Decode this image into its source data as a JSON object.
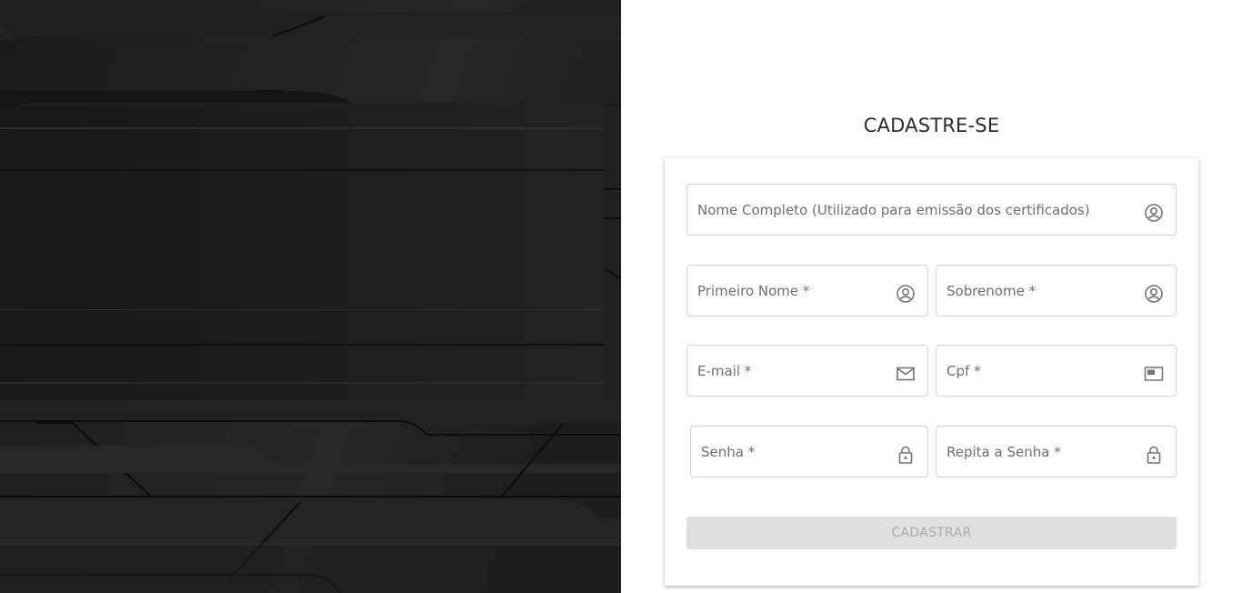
{
  "title": "CADASTRE-SE",
  "form": {
    "full_name": {
      "placeholder": "Nome Completo (Utilizado para emissão dos certificados)",
      "icon": "account-circle-icon"
    },
    "first_name": {
      "placeholder": "Primeiro Nome *",
      "icon": "account-circle-icon"
    },
    "last_name": {
      "placeholder": "Sobrenome *",
      "icon": "account-circle-icon"
    },
    "email": {
      "placeholder": "E-mail *",
      "icon": "mail-icon"
    },
    "cpf": {
      "placeholder": "Cpf *",
      "icon": "id-card-icon"
    },
    "password": {
      "placeholder": "Senha *",
      "icon": "lock-icon"
    },
    "password_confirm": {
      "placeholder": "Repita a Senha *",
      "icon": "lock-icon"
    },
    "submit_label": "CADASTRAR"
  },
  "colors": {
    "left_panel_bg": "#1c1c1c",
    "field_border": "#d4d4d4",
    "icon": "#757575",
    "button_disabled_bg": "#e0e0e0",
    "button_disabled_text": "#a9a9a9"
  }
}
